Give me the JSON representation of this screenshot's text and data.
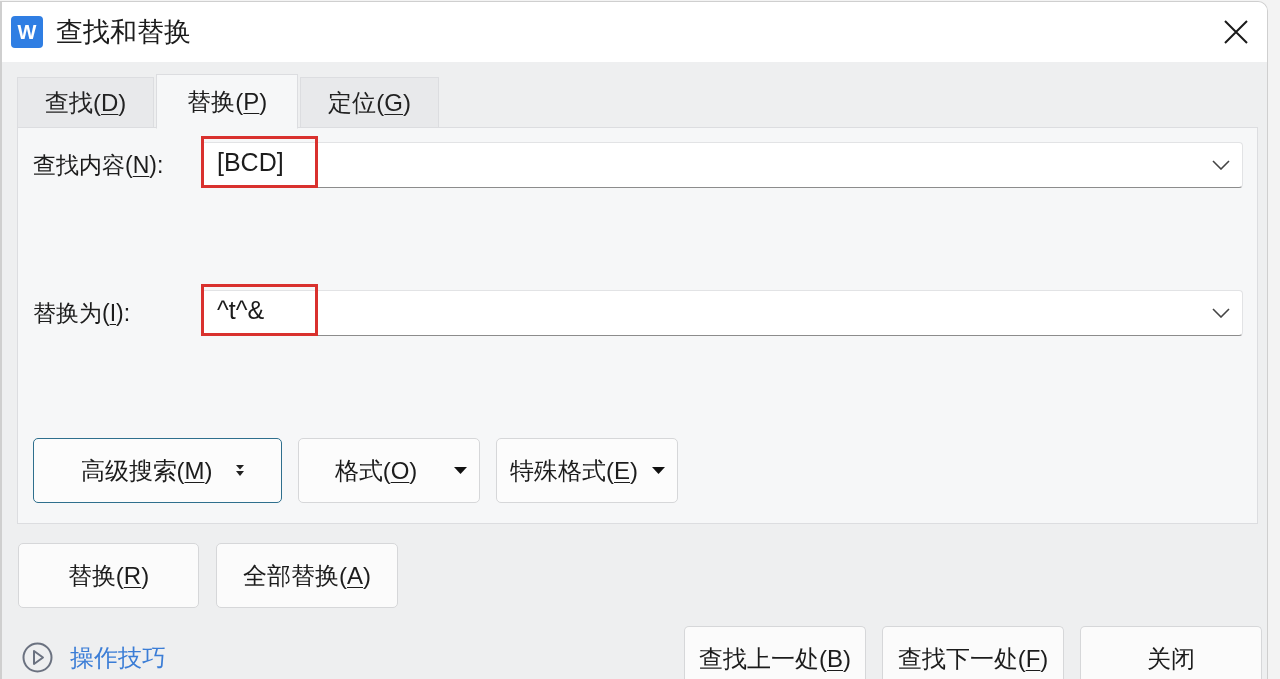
{
  "window": {
    "app_icon": "W",
    "title": "查找和替换"
  },
  "tabs": [
    {
      "label": "查找(D)",
      "selected": false
    },
    {
      "label": "替换(P)",
      "selected": true
    },
    {
      "label": "定位(G)",
      "selected": false
    }
  ],
  "fields": [
    {
      "label": "查找内容(N):",
      "value": "[BCD]",
      "highlighted": true
    },
    {
      "label": "替换为(I):",
      "value": "^t^&",
      "highlighted": true
    }
  ],
  "option_buttons": [
    {
      "label": "高级搜索(M)",
      "kind": "expand",
      "focused": true
    },
    {
      "label": "格式(O)",
      "kind": "dropdown",
      "focused": false
    },
    {
      "label": "特殊格式(E)",
      "kind": "dropdown",
      "focused": false
    }
  ],
  "action_buttons": [
    "替换(R)",
    "全部替换(A)"
  ],
  "footer": {
    "link": "操作技巧",
    "buttons": [
      "查找上一处(B)",
      "查找下一处(F)",
      "关闭"
    ]
  }
}
